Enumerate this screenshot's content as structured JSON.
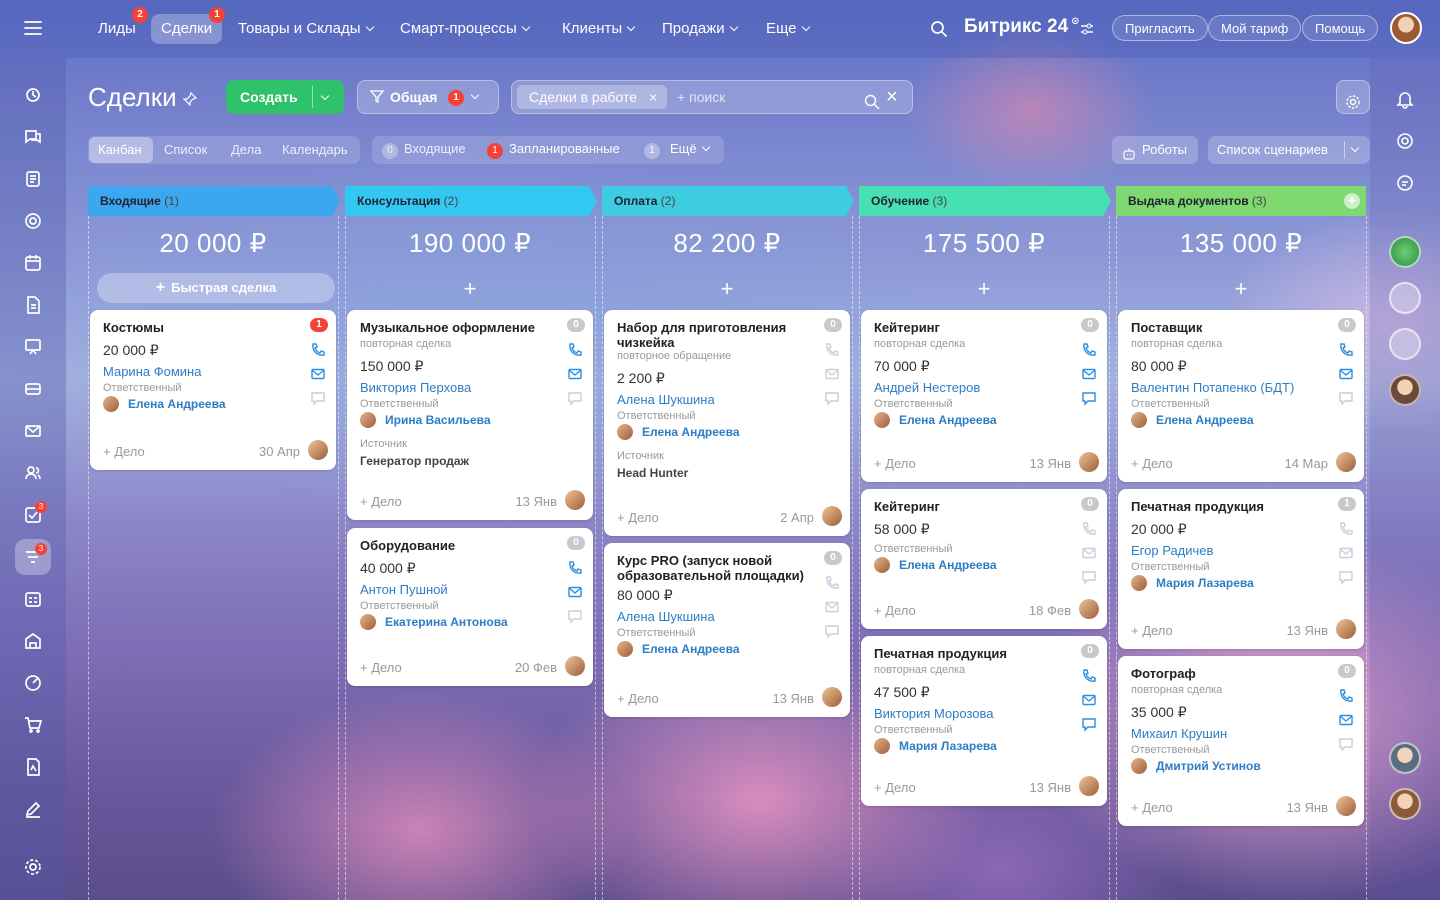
{
  "topnav": {
    "items": [
      {
        "label": "Лиды",
        "badge": "2"
      },
      {
        "label": "Сделки",
        "badge": "1"
      },
      {
        "label": "Товары и Склады"
      },
      {
        "label": "Смарт-процессы"
      },
      {
        "label": "Клиенты"
      },
      {
        "label": "Продажи"
      },
      {
        "label": "Еще"
      }
    ],
    "brand": "Битрикс 24",
    "invite": "Пригласить",
    "tariff": "Мой тариф",
    "help": "Помощь"
  },
  "toolbar": {
    "page_title": "Сделки",
    "create_label": "Создать",
    "pipeline_label": "Общая",
    "pipeline_badge": "1",
    "filter_chip": "Сделки в работе",
    "search_placeholder": "+ поиск"
  },
  "views": {
    "tabs": [
      "Канбан",
      "Список",
      "Дела",
      "Календарь"
    ],
    "counters": [
      {
        "count": "0",
        "label": "Входящие"
      },
      {
        "count": "1",
        "label": "Запланированные"
      },
      {
        "count": "1",
        "label": "Ещё"
      }
    ],
    "robots_label": "Роботы",
    "scenarios_label": "Список сценариев"
  },
  "sidebar": {
    "task_badge": "3",
    "funnel_badge": "3"
  },
  "colors": {
    "stage_1": "#3aa7ee",
    "stage_2": "#33c8f2",
    "stage_3": "#3ecde0",
    "stage_4": "#47e0b2",
    "stage_5": "#7fd870",
    "accent_green": "#2fc26b",
    "link": "#2d7dc4"
  },
  "kanban": {
    "quick_deal_label": "Быстрая сделка",
    "common": {
      "add_action": "+ Дело",
      "responsible_label": "Ответственный",
      "source_label": "Источник"
    },
    "stages": [
      {
        "name": "Входящие",
        "count": "(1)",
        "sum": "20 000 ₽",
        "cards": [
          {
            "title": "Костюмы",
            "price": "20 000 ₽",
            "client": "Марина Фомина",
            "responsible": "Елена Андреева",
            "date": "30 Апр",
            "counter": "1"
          }
        ]
      },
      {
        "name": "Консультация",
        "count": "(2)",
        "sum": "190 000 ₽",
        "cards": [
          {
            "title": "Музыкальное оформление",
            "sub": "повторная сделка",
            "price": "150 000 ₽",
            "client": "Виктория Перхова",
            "responsible": "Ирина Васильева",
            "source": "Генератор продаж",
            "date": "13 Янв",
            "counter": "0"
          },
          {
            "title": "Оборудование",
            "price": "40 000 ₽",
            "client": "Антон Пушной",
            "responsible": "Екатерина Антонова",
            "date": "20 Фев",
            "counter": "0"
          }
        ]
      },
      {
        "name": "Оплата",
        "count": "(2)",
        "sum": "82 200 ₽",
        "cards": [
          {
            "title": "Набор для приготовления чизкейка",
            "sub": "повторное обращение",
            "price": "2 200 ₽",
            "client": "Алена Шукшина",
            "responsible": "Елена Андреева",
            "source": "Head Hunter",
            "date": "2 Апр",
            "counter": "0"
          },
          {
            "title": "Курс PRO (запуск новой образовательной площадки)",
            "price": "80 000 ₽",
            "client": "Алена Шукшина",
            "responsible": "Елена Андреева",
            "date": "13 Янв",
            "counter": "0"
          }
        ]
      },
      {
        "name": "Обучение",
        "count": "(3)",
        "sum": "175 500 ₽",
        "cards": [
          {
            "title": "Кейтеринг",
            "sub": "повторная сделка",
            "price": "70 000 ₽",
            "client": "Андрей Нестеров",
            "responsible": "Елена Андреева",
            "date": "13 Янв",
            "counter": "0"
          },
          {
            "title": "Кейтеринг",
            "price": "58 000 ₽",
            "responsible": "Елена Андреева",
            "date": "18 Фев",
            "counter": "0"
          },
          {
            "title": "Печатная продукция",
            "sub": "повторная сделка",
            "price": "47 500 ₽",
            "client": "Виктория Морозова",
            "responsible": "Мария Лазарева",
            "date": "13 Янв",
            "counter": "0"
          }
        ]
      },
      {
        "name": "Выдача документов",
        "count": "(3)",
        "sum": "135 000 ₽",
        "cards": [
          {
            "title": "Поставщик",
            "sub": "повторная сделка",
            "price": "80 000 ₽",
            "client": "Валентин Потапенко (БДТ)",
            "responsible": "Елена Андреева",
            "date": "14 Мар",
            "counter": "0"
          },
          {
            "title": "Печатная продукция",
            "price": "20 000 ₽",
            "client": "Егор Радичев",
            "responsible": "Мария Лазарева",
            "date": "13 Янв",
            "counter": "1"
          },
          {
            "title": "Фотограф",
            "sub": "повторная сделка",
            "price": "35 000 ₽",
            "client": "Михаил Крушин",
            "responsible": "Дмитрий Устинов",
            "date": "13 Янв",
            "counter": "0"
          }
        ]
      }
    ]
  }
}
